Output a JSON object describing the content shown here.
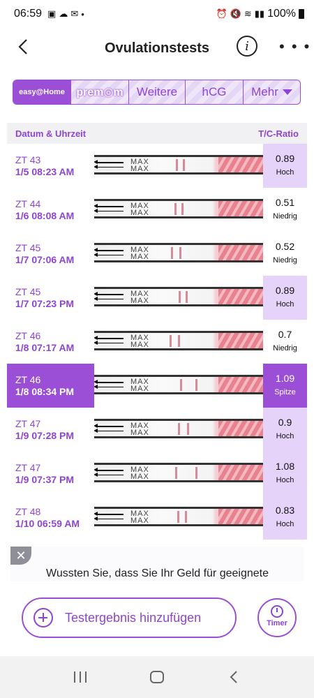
{
  "status_bar": {
    "time": "06:59",
    "battery": "100%"
  },
  "header": {
    "title": "Ovulationstests"
  },
  "tabs": [
    {
      "label": "easy@Home",
      "active": true
    },
    {
      "label": "prem◎m",
      "active": false
    },
    {
      "label": "Weitere",
      "active": false
    },
    {
      "label": "hCG",
      "active": false
    },
    {
      "label": "Mehr",
      "active": false
    }
  ],
  "columns": {
    "left": "Datum & Uhrzeit",
    "right": "T/C-Ratio"
  },
  "strip_text": "MAX\nMAX",
  "rows": [
    {
      "zt": "ZT 43",
      "date": "1/5  08:23 AM",
      "ratio": "0.89",
      "level": "Hoch",
      "style": "hi",
      "selected": false
    },
    {
      "zt": "ZT 44",
      "date": "1/6  08:08 AM",
      "ratio": "0.51",
      "level": "Niedrig",
      "style": "lo",
      "selected": false
    },
    {
      "zt": "ZT 45",
      "date": "1/7  07:06 AM",
      "ratio": "0.52",
      "level": "Niedrig",
      "style": "lo",
      "selected": false
    },
    {
      "zt": "ZT 45",
      "date": "1/7  07:23 PM",
      "ratio": "0.89",
      "level": "Hoch",
      "style": "hi",
      "selected": false
    },
    {
      "zt": "ZT 46",
      "date": "1/8  07:17 AM",
      "ratio": "0.7",
      "level": "Niedrig",
      "style": "lo",
      "selected": false
    },
    {
      "zt": "ZT 46",
      "date": "1/8  08:34 PM",
      "ratio": "1.09",
      "level": "Spitze",
      "style": "peak",
      "selected": true
    },
    {
      "zt": "ZT 47",
      "date": "1/9  07:28 PM",
      "ratio": "0.9",
      "level": "Hoch",
      "style": "hi",
      "selected": false
    },
    {
      "zt": "ZT 47",
      "date": "1/9  07:37 PM",
      "ratio": "1.08",
      "level": "Hoch",
      "style": "hi",
      "selected": false
    },
    {
      "zt": "ZT 48",
      "date": "1/10  06:59 AM",
      "ratio": "0.83",
      "level": "Hoch",
      "style": "hi",
      "selected": false
    }
  ],
  "banner": {
    "text": "Wussten Sie, dass Sie Ihr Geld für geeignete"
  },
  "actions": {
    "add_label": "Testergebnis hinzufügen",
    "timer_label": "Timer"
  },
  "icons": {
    "back": "chevron-left-icon",
    "info": "info-icon",
    "more": "more-dots-icon",
    "add": "plus-circle-icon",
    "timer": "stopwatch-icon"
  },
  "colors": {
    "accent": "#9a4fd6",
    "accent_text": "#8e44d4",
    "high_bg": "#e6d3fa"
  }
}
